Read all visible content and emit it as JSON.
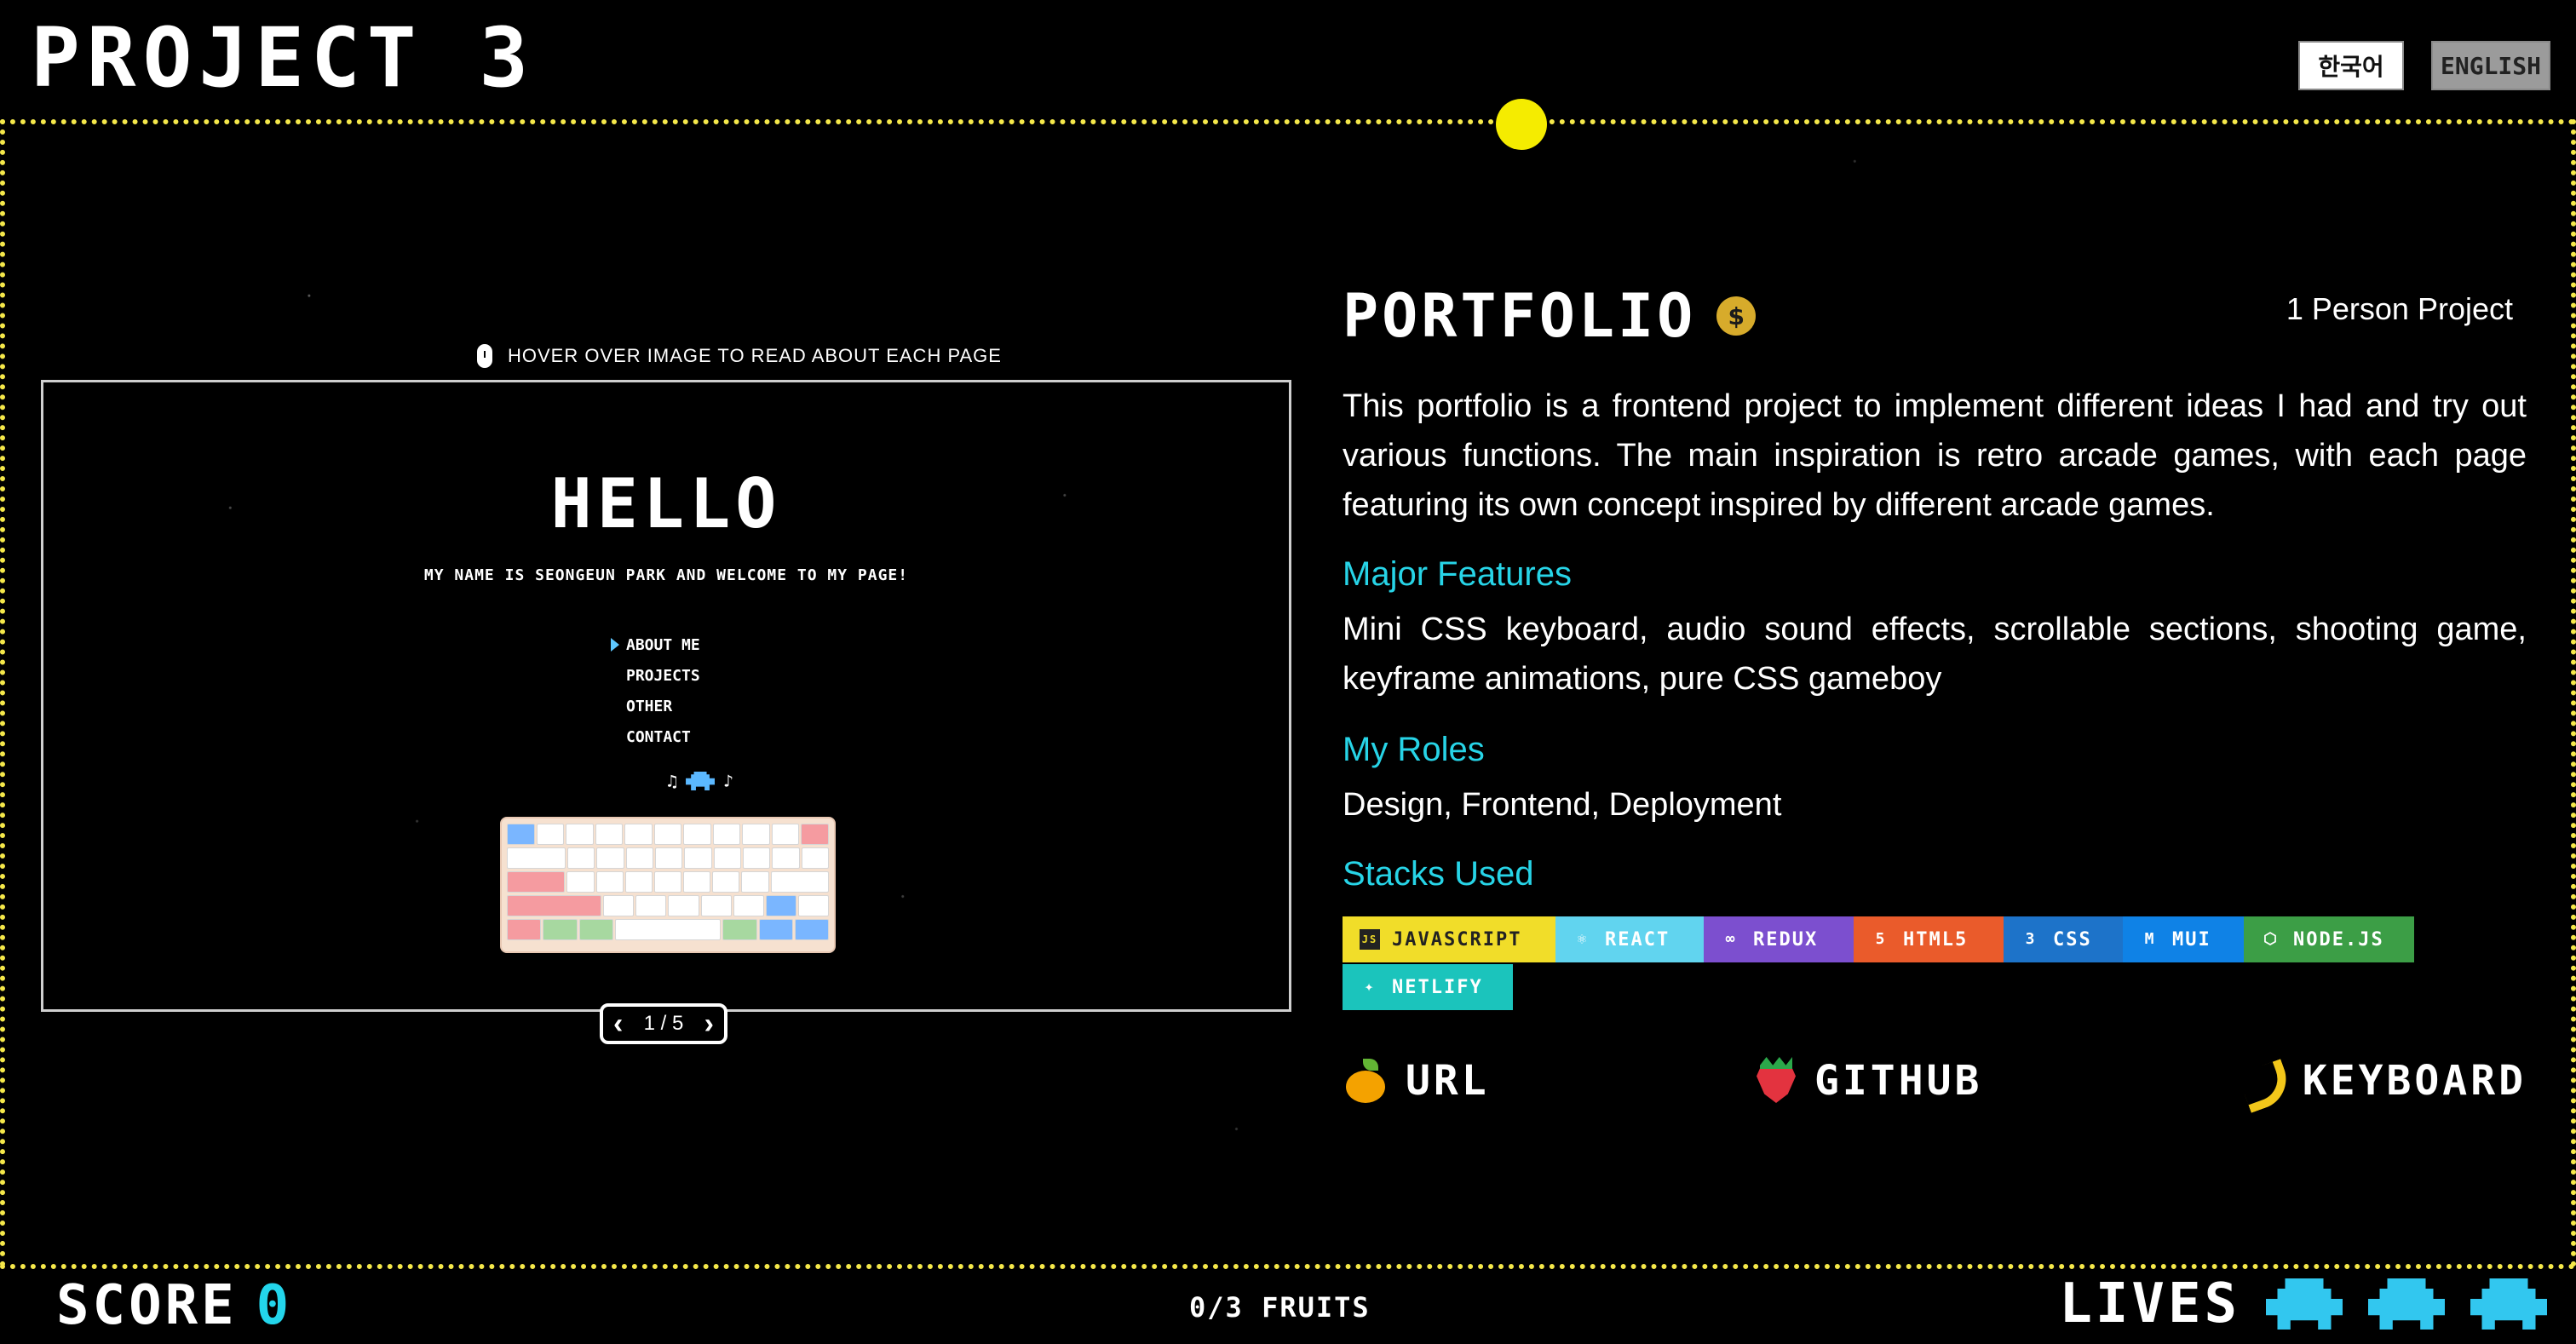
{
  "header": {
    "title": "PROJECT 3",
    "lang_ko": "한국어",
    "lang_en": "ENGLISH"
  },
  "preview": {
    "hint": "HOVER OVER IMAGE TO READ ABOUT EACH PAGE",
    "hello": "HELLO",
    "subtitle": "MY NAME IS SEONGEUN PARK AND WELCOME TO MY PAGE!",
    "menu": [
      "ABOUT ME",
      "PROJECTS",
      "OTHER",
      "CONTACT"
    ],
    "page_indicator": "1 / 5"
  },
  "project": {
    "name": "PORTFOLIO",
    "team": "1 Person Project",
    "description": "This portfolio is a frontend project to implement different ideas I had and try out various functions. The main inspiration is retro arcade games, with each page featuring its own concept inspired by different arcade games.",
    "major_features_title": "Major Features",
    "major_features": "Mini CSS keyboard, audio sound effects, scrollable sections, shooting game, keyframe animations, pure CSS gameboy",
    "roles_title": "My Roles",
    "roles": "Design, Frontend, Deployment",
    "stacks_title": "Stacks Used",
    "stacks": [
      {
        "label": "JAVASCRIPT",
        "icon": "javascript-icon",
        "color": "#f1dd29"
      },
      {
        "label": "REACT",
        "icon": "react-icon",
        "color": "#61d4ef"
      },
      {
        "label": "REDUX",
        "icon": "redux-icon",
        "color": "#7c4fcf"
      },
      {
        "label": "HTML5",
        "icon": "html5-icon",
        "color": "#ea5b2b"
      },
      {
        "label": "CSS",
        "icon": "css-icon",
        "color": "#1d73c9"
      },
      {
        "label": "MUI",
        "icon": "mui-icon",
        "color": "#0f82e6"
      },
      {
        "label": "NODE.JS",
        "icon": "nodejs-icon",
        "color": "#3c9e46"
      },
      {
        "label": "NETLIFY",
        "icon": "netlify-icon",
        "color": "#1bc4bc"
      }
    ],
    "links": {
      "url": "URL",
      "github": "GITHUB",
      "keyboard": "KEYBOARD"
    }
  },
  "footer": {
    "score_label": "SCORE",
    "score_value": "0",
    "fruits": "0/3 FRUITS",
    "lives_label": "LIVES"
  },
  "colors": {
    "accent_cyan": "#27d4e7",
    "track_yellow": "#f5e84a",
    "pacman_yellow": "#f5ec00"
  }
}
